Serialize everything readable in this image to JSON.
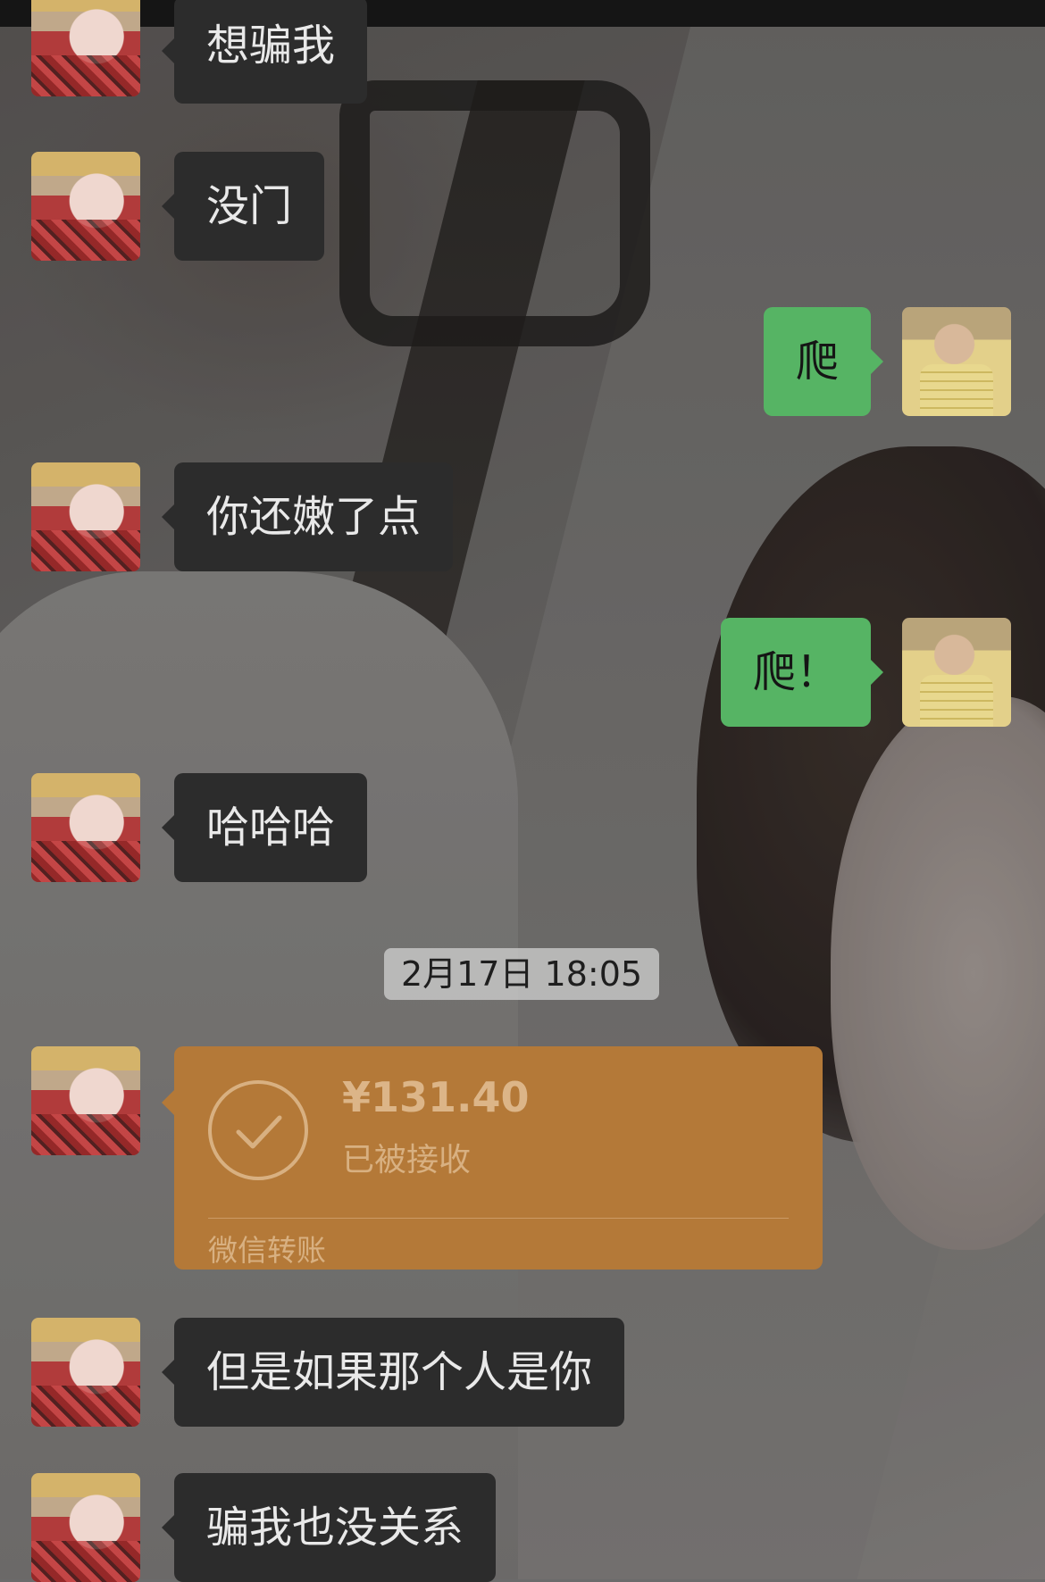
{
  "messages": [
    {
      "side": "left",
      "text": "想骗我"
    },
    {
      "side": "left",
      "text": "没门"
    },
    {
      "side": "right",
      "text": "爬"
    },
    {
      "side": "left",
      "text": "你还嫩了点"
    },
    {
      "side": "right",
      "text": "爬！"
    },
    {
      "side": "left",
      "text": "哈哈哈"
    },
    {
      "side": "left",
      "text": "但是如果那个人是你"
    },
    {
      "side": "left",
      "text": "骗我也没关系"
    }
  ],
  "timestamp": "2月17日 18:05",
  "transfer": {
    "amount": "¥131.40",
    "status": "已被接收",
    "label": "微信转账",
    "color": "#b47938"
  },
  "colors": {
    "incoming_bubble": "#2c2c2c",
    "outgoing_bubble": "#56b464"
  }
}
